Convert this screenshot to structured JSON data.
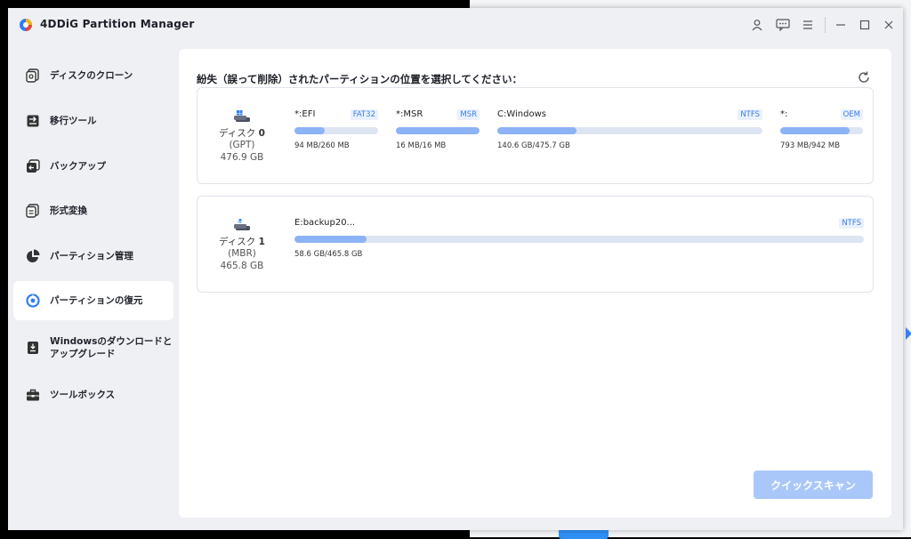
{
  "app": {
    "title": "4DDiG Partition Manager"
  },
  "sidebar": {
    "items": [
      {
        "label": "ディスクのクローン",
        "icon": "disk-clone-icon"
      },
      {
        "label": "移行ツール",
        "icon": "migrate-icon"
      },
      {
        "label": "バックアップ",
        "icon": "backup-icon"
      },
      {
        "label": "形式変換",
        "icon": "convert-icon"
      },
      {
        "label": "パーティション管理",
        "icon": "pie-chart-icon"
      },
      {
        "label": "パーティションの復元",
        "icon": "partition-recovery-icon"
      },
      {
        "label": "Windowsのダウンロードと\nアップグレード",
        "icon": "windows-download-icon"
      },
      {
        "label": "ツールボックス",
        "icon": "toolbox-icon"
      }
    ],
    "active_index": 5
  },
  "main": {
    "title": "紛失（誤って削除）されたパーティションの位置を選択してください：",
    "scan_button": "クイックスキャン"
  },
  "disks": [
    {
      "name_prefix": "ディスク",
      "name_num": "0",
      "type": "(GPT)",
      "size": "476.9 GB",
      "partitions": [
        {
          "label": "*:EFI",
          "fs": "FAT32",
          "usage": "94 MB/260 MB",
          "fill": 0.36
        },
        {
          "label": "*:MSR",
          "fs": "MSR",
          "usage": "16 MB/16 MB",
          "fill": 1.0
        },
        {
          "label": "C:Windows",
          "fs": "NTFS",
          "usage": "140.6 GB/475.7 GB",
          "fill": 0.3
        },
        {
          "label": "*:",
          "fs": "OEM",
          "usage": "793 MB/942 MB",
          "fill": 0.84
        }
      ]
    },
    {
      "name_prefix": "ディスク",
      "name_num": "1",
      "type": "(MBR)",
      "size": "465.8 GB",
      "partitions": [
        {
          "label": "E:backup20...",
          "fs": "NTFS",
          "usage": "58.6 GB/465.8 GB",
          "fill": 0.126
        }
      ]
    }
  ],
  "colors": {
    "accent": "#3b7de8",
    "bar_fill": "#8cb3f5",
    "bar_track": "#dde5f2",
    "button_disabled": "#a9c8f9"
  }
}
